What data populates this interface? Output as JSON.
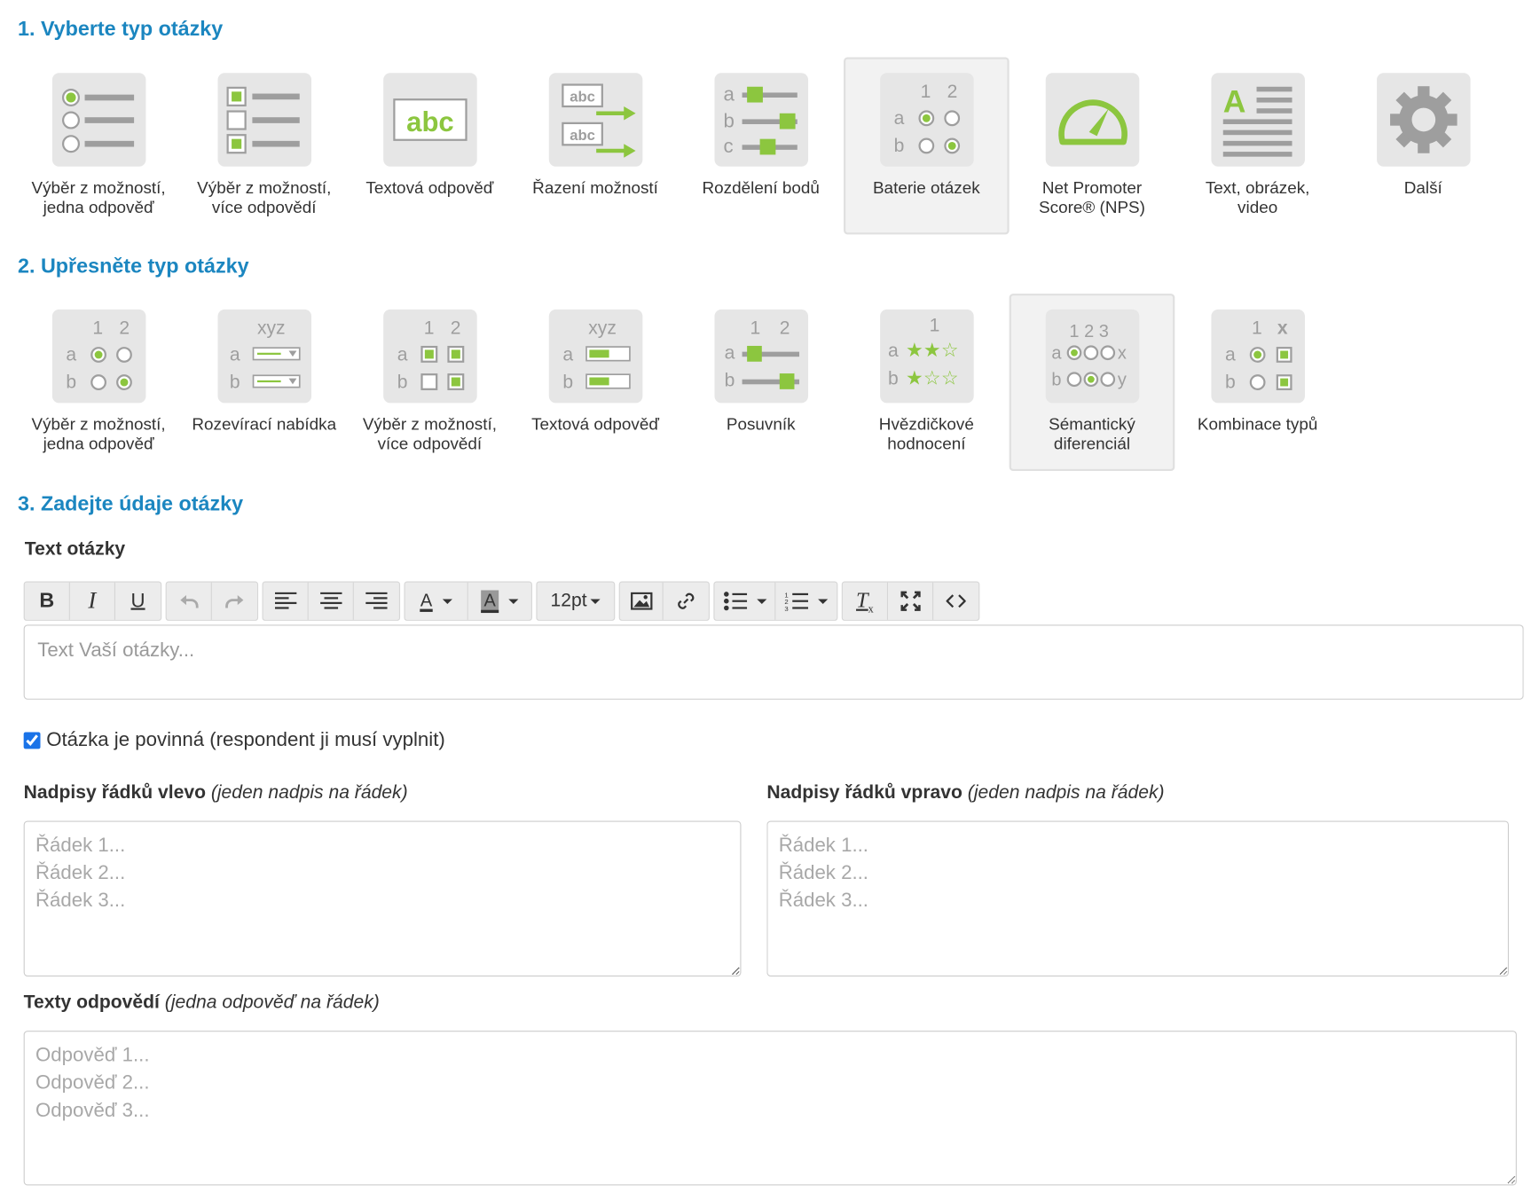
{
  "section1": {
    "title": "1. Vyberte typ otázky",
    "types": [
      {
        "label": "Výběr z možností,\njedna odpověď",
        "icon": "radio-list-icon"
      },
      {
        "label": "Výběr z možností,\nvíce odpovědí",
        "icon": "checkbox-list-icon"
      },
      {
        "label": "Textová odpověď",
        "icon": "text-abc-icon"
      },
      {
        "label": "Řazení možností",
        "icon": "ordering-icon"
      },
      {
        "label": "Rozdělení bodů",
        "icon": "sliders-icon"
      },
      {
        "label": "Baterie otázek",
        "icon": "matrix-icon",
        "selected": true
      },
      {
        "label": "Net Promoter\nScore® (NPS)",
        "icon": "gauge-icon"
      },
      {
        "label": "Text, obrázek,\nvideo",
        "icon": "text-block-icon"
      },
      {
        "label": "Další",
        "icon": "gear-icon"
      }
    ]
  },
  "section2": {
    "title": "2. Upřesněte typ otázky",
    "types": [
      {
        "label": "Výběr z možností,\njedna odpověď",
        "icon": "matrix-radio-icon"
      },
      {
        "label": "Rozevírací nabídka",
        "icon": "matrix-dropdown-icon"
      },
      {
        "label": "Výběr z možností,\nvíce odpovědí",
        "icon": "matrix-checkbox-icon"
      },
      {
        "label": "Textová odpověď",
        "icon": "matrix-text-icon"
      },
      {
        "label": "Posuvník",
        "icon": "matrix-slider-icon"
      },
      {
        "label": "Hvězdičkové\nhodnocení",
        "icon": "matrix-stars-icon"
      },
      {
        "label": "Sémantický\ndiferenciál",
        "icon": "semantic-differential-icon",
        "selected": true
      },
      {
        "label": "Kombinace typů",
        "icon": "matrix-combination-icon"
      }
    ]
  },
  "section3": {
    "title": "3. Zadejte údaje otázky",
    "question_text_label": "Text otázky",
    "font_size": "12pt",
    "editor_placeholder": "Text Vaší otázky...",
    "required_label": "Otázka je povinná (respondent ji musí vyplnit)",
    "required_checked": true,
    "left_rows_label": "Nadpisy řádků vlevo",
    "left_rows_hint": "(jeden nadpis na řádek)",
    "left_rows_placeholder": "Řádek 1...\nŘádek 2...\nŘádek 3...",
    "right_rows_label": "Nadpisy řádků vpravo",
    "right_rows_hint": "(jeden nadpis na řádek)",
    "right_rows_placeholder": "Řádek 1...\nŘádek 2...\nŘádek 3...",
    "answers_label": "Texty odpovědí",
    "answers_hint": "(jedna odpověď na řádek)",
    "answers_placeholder": "Odpověď 1...\nOdpověď 2...\nOdpověď 3..."
  },
  "colors": {
    "accent_green": "#8cc63f",
    "title_blue": "#1b86c0",
    "icon_gray": "#9e9e9e"
  }
}
